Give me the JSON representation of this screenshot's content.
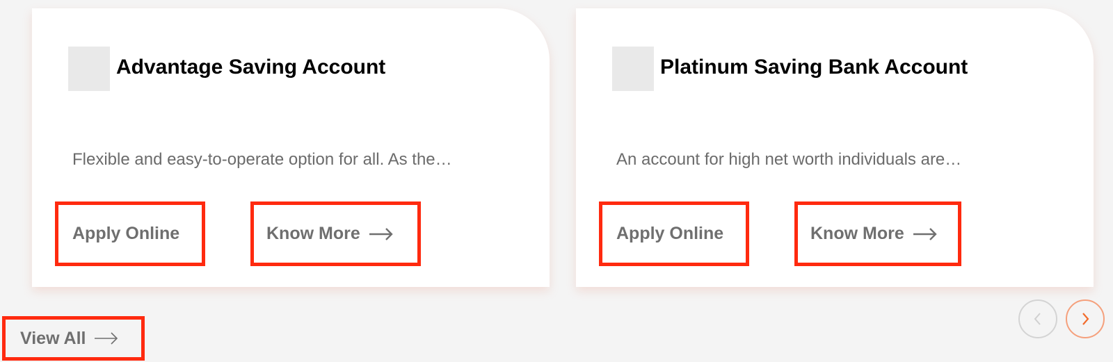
{
  "cards": [
    {
      "title": "Advantage Saving Account",
      "description": "Flexible and easy-to-operate option for all. As the…",
      "apply_label": "Apply Online",
      "know_label": "Know More"
    },
    {
      "title": "Platinum Saving Bank Account",
      "description": "An account for high net worth individuals are…",
      "apply_label": "Apply Online",
      "know_label": "Know More"
    }
  ],
  "view_all_label": "View All",
  "icons": {
    "arrow": "arrow-right-icon",
    "prev": "chevron-left-icon",
    "next": "chevron-right-icon",
    "card_image": "account-image-placeholder"
  },
  "colors": {
    "highlight_border": "#ff2a0f",
    "accent": "#f26b2b",
    "background": "#f4f4f4",
    "card_bg": "#ffffff",
    "muted_text": "#6f6f6f"
  }
}
